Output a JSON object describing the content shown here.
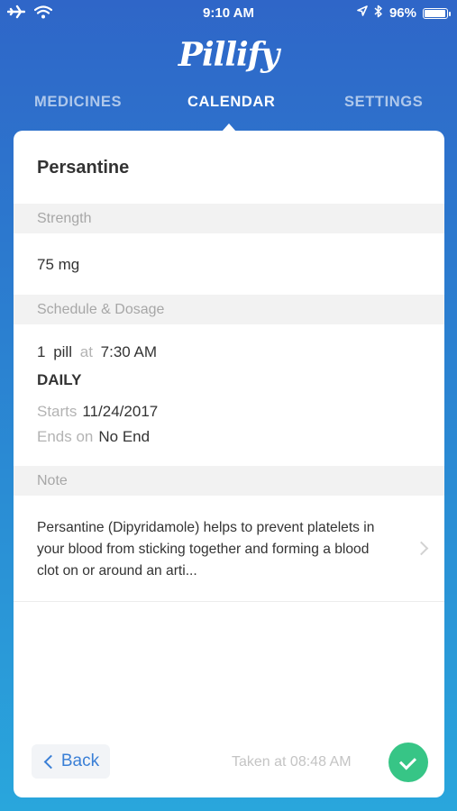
{
  "status_bar": {
    "time": "9:10 AM",
    "battery_percent": "96%",
    "battery_level": 0.96,
    "icons": [
      "airplane-icon",
      "wifi-icon",
      "location-icon",
      "bluetooth-icon",
      "battery-icon"
    ]
  },
  "app": {
    "logo_text": "Pillify"
  },
  "tabs": [
    {
      "label": "MEDICINES",
      "active": false
    },
    {
      "label": "CALENDAR",
      "active": true
    },
    {
      "label": "SETTINGS",
      "active": false
    }
  ],
  "medicine": {
    "name": "Persantine",
    "strength_header": "Strength",
    "strength_value": "75 mg",
    "schedule_header": "Schedule & Dosage",
    "dose_count": "1",
    "dose_unit": "pill",
    "at_label": "at",
    "dose_time": "7:30 AM",
    "frequency": "DAILY",
    "starts_label": "Starts",
    "starts_value": "11/24/2017",
    "ends_label": "Ends on",
    "ends_value": "No End",
    "note_header": "Note",
    "note_text": "Persantine (Dipyridamole) helps to prevent platelets in your blood from sticking together and forming a blood clot on or around an arti..."
  },
  "actions": {
    "back_label": "Back",
    "taken_text": "Taken at 08:48 AM"
  },
  "colors": {
    "accent": "#3a7fd6",
    "confirm": "#37c586",
    "gradient_top": "#2f66c8",
    "gradient_bottom": "#29a6dc"
  }
}
